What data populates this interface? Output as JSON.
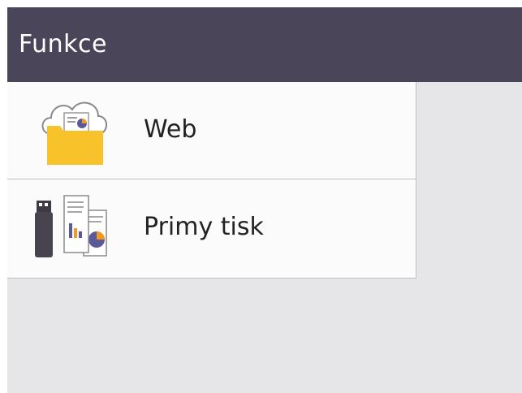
{
  "header": {
    "title": "Funkce"
  },
  "menu": {
    "items": [
      {
        "label": "Web",
        "icon": "cloud-folder-icon"
      },
      {
        "label": "Primy tisk",
        "icon": "usb-document-icon"
      }
    ]
  },
  "colors": {
    "header_bg": "#4a4558",
    "panel_bg": "#e6e6e9",
    "folder": "#f7c22a",
    "accent_purple": "#5a5a9a",
    "accent_orange": "#f39a1e"
  }
}
